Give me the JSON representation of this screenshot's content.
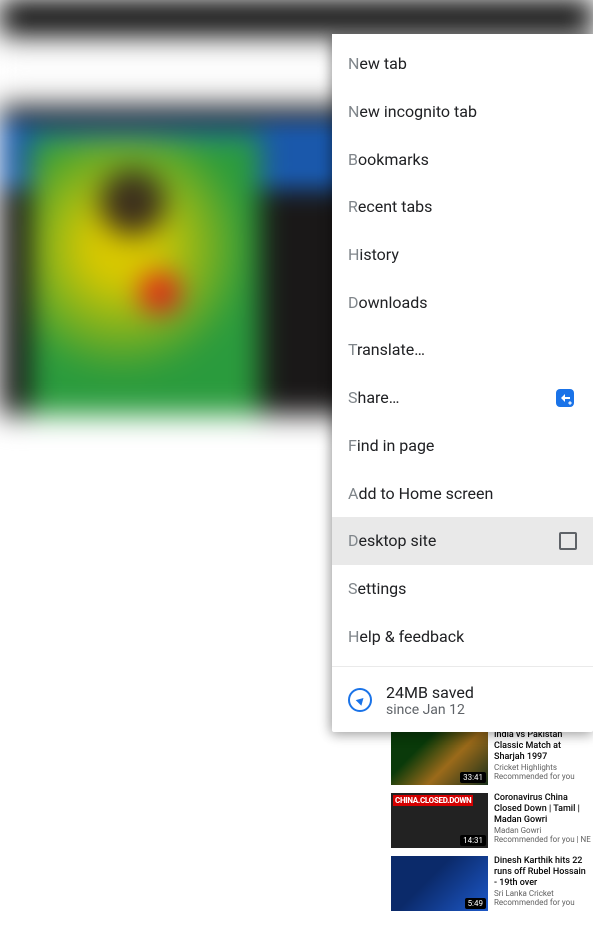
{
  "menu": {
    "new_tab": "New tab",
    "new_incognito": "New incognito tab",
    "bookmarks": "Bookmarks",
    "recent_tabs": "Recent tabs",
    "history": "History",
    "downloads": "Downloads",
    "translate": "Translate…",
    "share": "Share…",
    "find_in_page": "Find in page",
    "add_to_home": "Add to Home screen",
    "desktop_site": "Desktop site",
    "settings": "Settings",
    "help_feedback": "Help & feedback",
    "data_saved_title": "24MB saved",
    "data_saved_sub": "since Jan 12"
  },
  "sidebar_videos": [
    {
      "title": "India vs Pakistan Classic Match at Sharjah 1997",
      "channel": "Cricket Highlights",
      "rec": "Recommended for you",
      "duration": "33:41"
    },
    {
      "title": "Coronavirus China Closed Down | Tamil | Madan Gowri",
      "channel": "Madan Gowri",
      "rec": "Recommended for you | NE",
      "duration": "14:31"
    },
    {
      "title": "Dinesh Karthik hits 22 runs off Rubel Hossain - 19th over",
      "channel": "Sri Lanka Cricket",
      "rec": "Recommended for you",
      "duration": "5:49"
    }
  ]
}
